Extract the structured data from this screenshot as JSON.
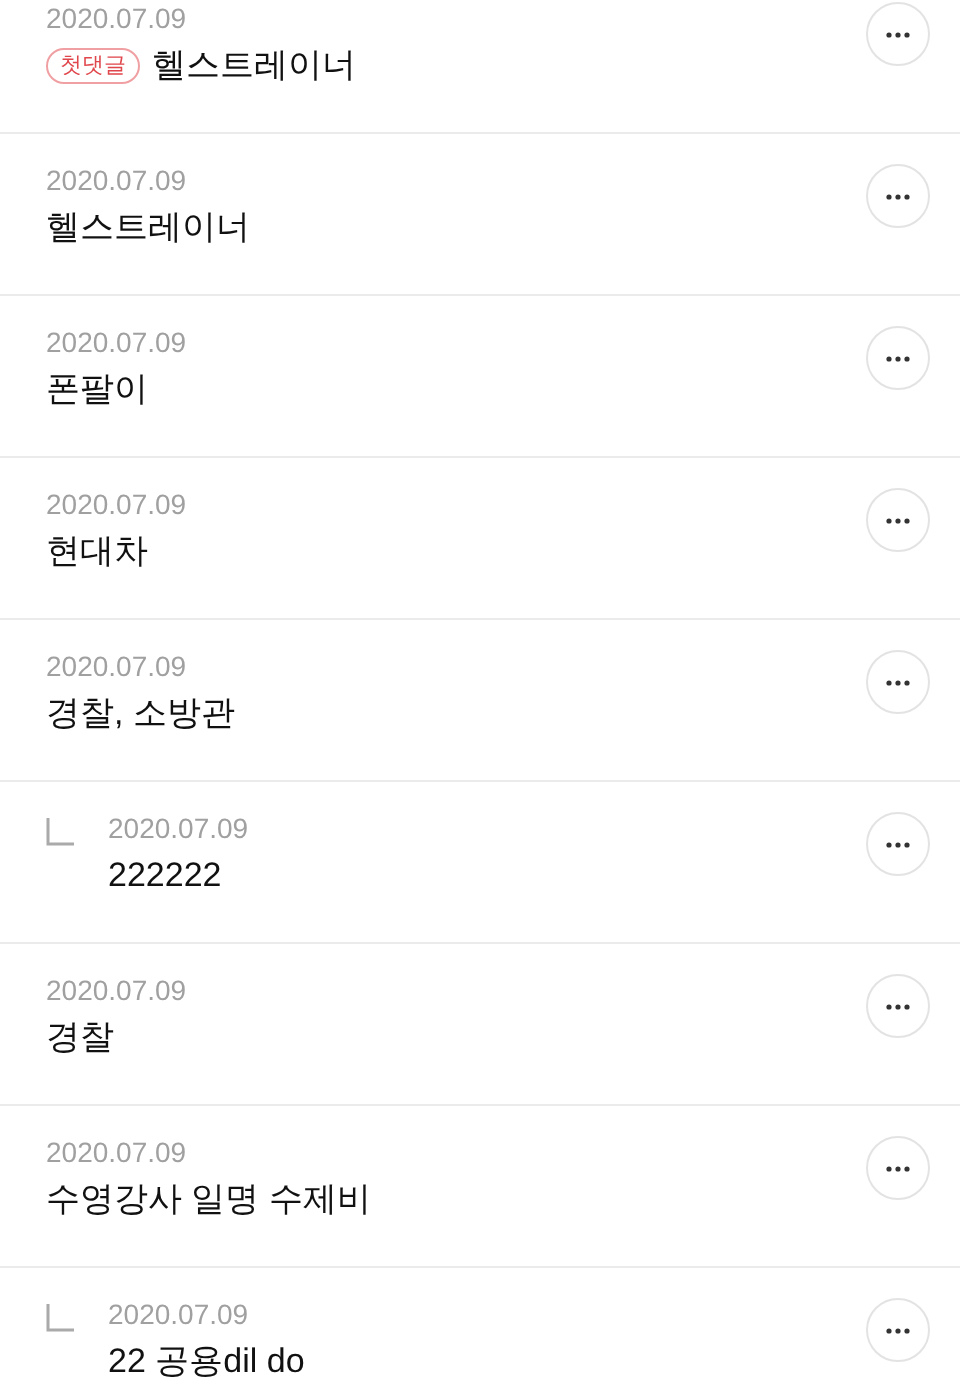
{
  "comments": [
    {
      "date": "2020.07.09",
      "badge": "첫댓글",
      "text": "헬스트레이너"
    },
    {
      "date": "2020.07.09",
      "text": "헬스트레이너"
    },
    {
      "date": "2020.07.09",
      "text": "폰팔이"
    },
    {
      "date": "2020.07.09",
      "text": "현대차"
    },
    {
      "date": "2020.07.09",
      "text": "경찰, 소방관",
      "children": [
        {
          "date": "2020.07.09",
          "text": "222222"
        }
      ]
    },
    {
      "date": "2020.07.09",
      "text": "경찰"
    },
    {
      "date": "2020.07.09",
      "text": "수영강사 일명 수제비",
      "children": [
        {
          "date": "2020.07.09",
          "text": "22 공용dil do"
        }
      ]
    }
  ]
}
